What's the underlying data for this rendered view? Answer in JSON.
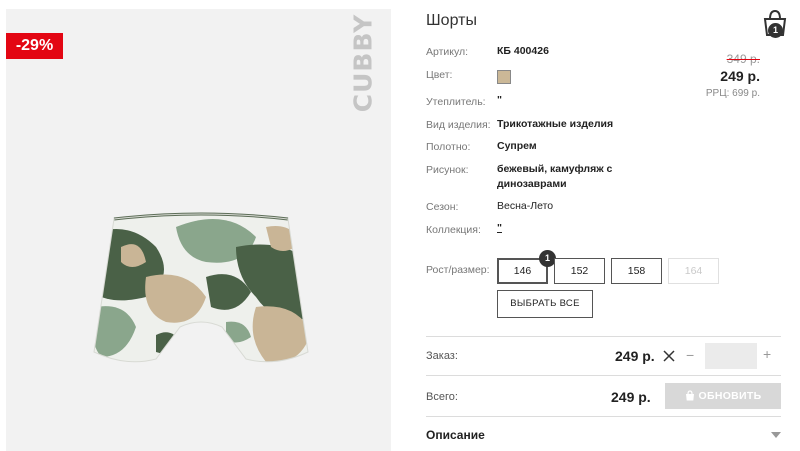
{
  "product": {
    "discount": "-29%",
    "brand": "CUBBY",
    "title": "Шорты",
    "cart_count": "1",
    "color_swatch": "#cbb897"
  },
  "specs": [
    {
      "label": "Артикул:",
      "value": "КБ 400426"
    },
    {
      "label": "Цвет:",
      "value": ""
    },
    {
      "label": "Утеплитель:",
      "value": "\""
    },
    {
      "label": "Вид изделия:",
      "value": "Трикотажные изделия"
    },
    {
      "label": "Полотно:",
      "value": "Супрем"
    },
    {
      "label": "Рисунок:",
      "value": "бежевый, камуфляж с динозаврами"
    },
    {
      "label": "Сезон:",
      "value": "Весна-Лето"
    },
    {
      "label": "Коллекция:",
      "value": "\""
    }
  ],
  "price": {
    "old": "349 р.",
    "new": "249 р.",
    "rrp": "РРЦ: 699 р."
  },
  "sizes": {
    "label": "Рост/размер:",
    "options": [
      "146",
      "152",
      "158",
      "164"
    ],
    "selected_badge": "1",
    "select_all": "ВЫБРАТЬ ВСЕ"
  },
  "order": {
    "label": "Заказ:",
    "price": "249 р.",
    "minus": "−",
    "plus": "+"
  },
  "total": {
    "label": "Всего:",
    "price": "249 р.",
    "update_button": "ОБНОВИТЬ"
  },
  "description": {
    "label": "Описание"
  },
  "colors": {
    "badge_red": "#e30613",
    "camo_dark": "#4a6147",
    "camo_mid": "#8aa68c",
    "camo_light": "#c9b596"
  }
}
